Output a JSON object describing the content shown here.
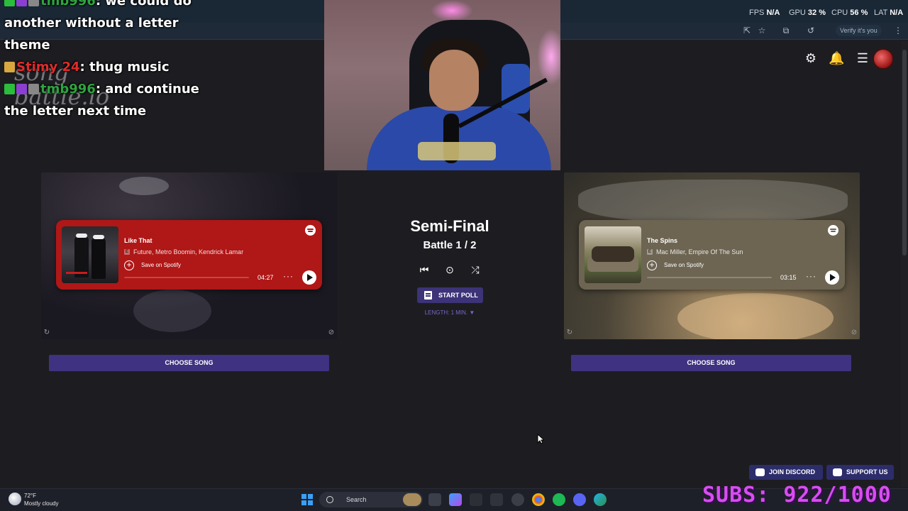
{
  "browser": {
    "perf": [
      {
        "label": "FPS",
        "value": "N/A"
      },
      {
        "label": "GPU",
        "value": "32 %"
      },
      {
        "label": "CPU",
        "value": "56 %"
      },
      {
        "label": "LAT",
        "value": "N/A"
      }
    ],
    "verify_label": "Verify it's you"
  },
  "chat": {
    "messages": [
      {
        "user": "tmb996",
        "user_color": "#2ea43f",
        "text": ": we could do another without a letter theme",
        "lines": [
          "we could do",
          "another without a letter",
          "theme"
        ]
      },
      {
        "user": "Stimy 24",
        "user_color": "#e02b2b",
        "text": ": thug music"
      },
      {
        "user": "tmb996",
        "user_color": "#2ea43f",
        "text": ": and continue the letter next time",
        "lines": [
          "and continue",
          "the letter next time"
        ]
      }
    ]
  },
  "site": {
    "logo_text_1": "song",
    "logo_text_2": "battle.io",
    "header_icons": [
      "gear-icon",
      "bell-icon",
      "menu-icon"
    ]
  },
  "battle": {
    "round": "Semi-Final",
    "battle_label": "Battle 1 / 2",
    "start_poll": "START POLL",
    "length": "LENGTH: 1 MIN. ▼"
  },
  "songs": [
    {
      "title": "Like That",
      "artists": "Future, Metro Boomin, Kendrick Lamar",
      "explicit": "E",
      "save_label": "Save on Spotify",
      "duration": "04:27",
      "progress": 0,
      "player_color": "#b01717",
      "choose_label": "CHOOSE SONG"
    },
    {
      "title": "The Spins",
      "artists": "Mac Miller, Empire Of The Sun",
      "explicit": "E",
      "save_label": "Save on Spotify",
      "duration": "03:15",
      "progress": 0,
      "player_color": "#6d6552",
      "choose_label": "CHOOSE SONG"
    }
  ],
  "footer": {
    "discord_label": "JOIN DISCORD",
    "support_label": "SUPPORT US"
  },
  "taskbar": {
    "weather_temp": "72°F",
    "weather_cond": "Mostly cloudy",
    "search_label": "Search"
  },
  "overlay": {
    "subs": "SUBS: 922/1000"
  },
  "colors": {
    "accent": "#3f3280",
    "page_bg": "#1d1d21",
    "subs": "#d94cf2"
  }
}
